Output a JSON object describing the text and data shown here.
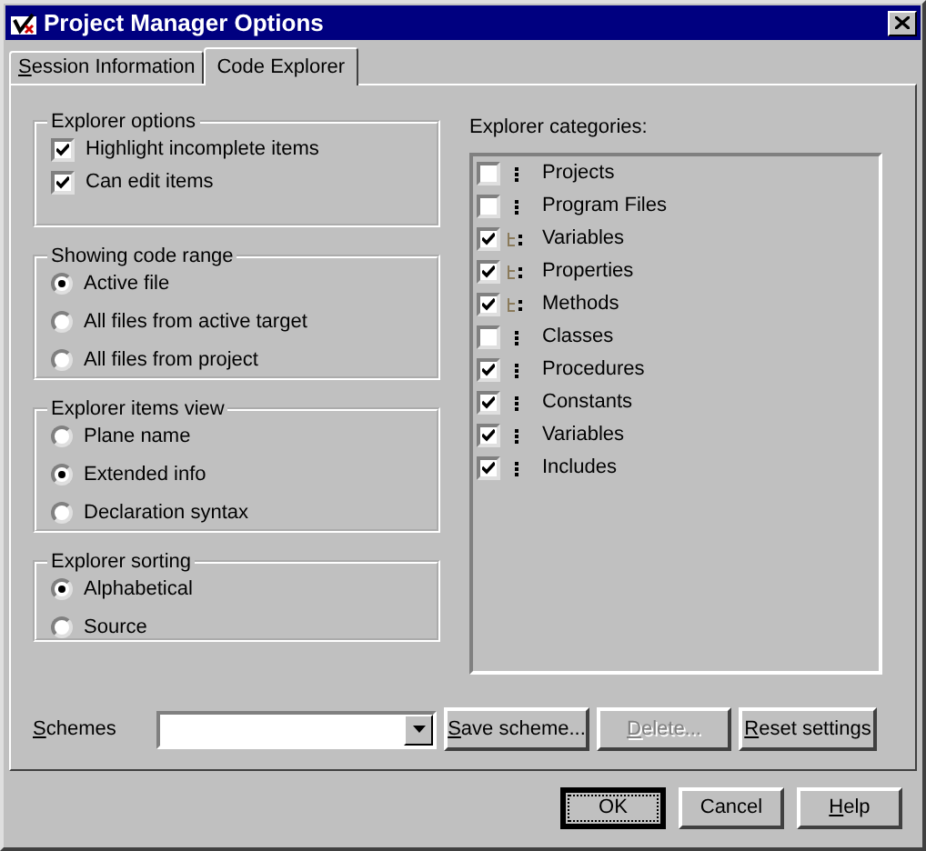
{
  "window": {
    "title": "Project Manager Options"
  },
  "tabs": [
    {
      "label": "Session Information",
      "mnemonic": true,
      "selected": false
    },
    {
      "label": "Code Explorer",
      "mnemonic": false,
      "selected": true
    }
  ],
  "groups": [
    {
      "title": "Explorer options",
      "kind": "checkbox",
      "items": [
        {
          "label": "Highlight incomplete items",
          "checked": true
        },
        {
          "label": "Can edit items",
          "checked": true
        }
      ]
    },
    {
      "title": "Showing code range",
      "kind": "radio",
      "items": [
        {
          "label": "Active file",
          "selected": true
        },
        {
          "label": "All files from active target",
          "selected": false
        },
        {
          "label": "All files from project",
          "selected": false
        }
      ]
    },
    {
      "title": "Explorer items view",
      "kind": "radio",
      "items": [
        {
          "label": "Plane name",
          "selected": false
        },
        {
          "label": "Extended info",
          "selected": true
        },
        {
          "label": "Declaration syntax",
          "selected": false
        }
      ]
    },
    {
      "title": "Explorer sorting",
      "kind": "radio",
      "items": [
        {
          "label": "Alphabetical",
          "selected": true
        },
        {
          "label": "Source",
          "selected": false
        }
      ]
    }
  ],
  "categories": {
    "label": "Explorer categories:",
    "items": [
      {
        "label": "Projects",
        "checked": false,
        "kind": "dots"
      },
      {
        "label": "Program Files",
        "checked": false,
        "kind": "dots"
      },
      {
        "label": "Variables",
        "checked": true,
        "kind": "tree"
      },
      {
        "label": "Properties",
        "checked": true,
        "kind": "tree"
      },
      {
        "label": "Methods",
        "checked": true,
        "kind": "tree"
      },
      {
        "label": "Classes",
        "checked": false,
        "kind": "dots"
      },
      {
        "label": "Procedures",
        "checked": true,
        "kind": "dots"
      },
      {
        "label": "Constants",
        "checked": true,
        "kind": "dots"
      },
      {
        "label": "Variables",
        "checked": true,
        "kind": "dots"
      },
      {
        "label": "Includes",
        "checked": true,
        "kind": "dots"
      }
    ]
  },
  "schemes": {
    "label": "Schemes",
    "mnemonic": true,
    "buttons": [
      {
        "label": "Save scheme...",
        "mnemonic": true,
        "disabled": false
      },
      {
        "label": "Delete...",
        "mnemonic": true,
        "disabled": true
      },
      {
        "label": "Reset settings",
        "mnemonic": true,
        "disabled": false
      }
    ]
  },
  "dialog_buttons": [
    {
      "label": "OK",
      "mnemonic": false,
      "default": true
    },
    {
      "label": "Cancel",
      "mnemonic": false,
      "default": false
    },
    {
      "label": "Help",
      "mnemonic": true,
      "default": false
    }
  ]
}
